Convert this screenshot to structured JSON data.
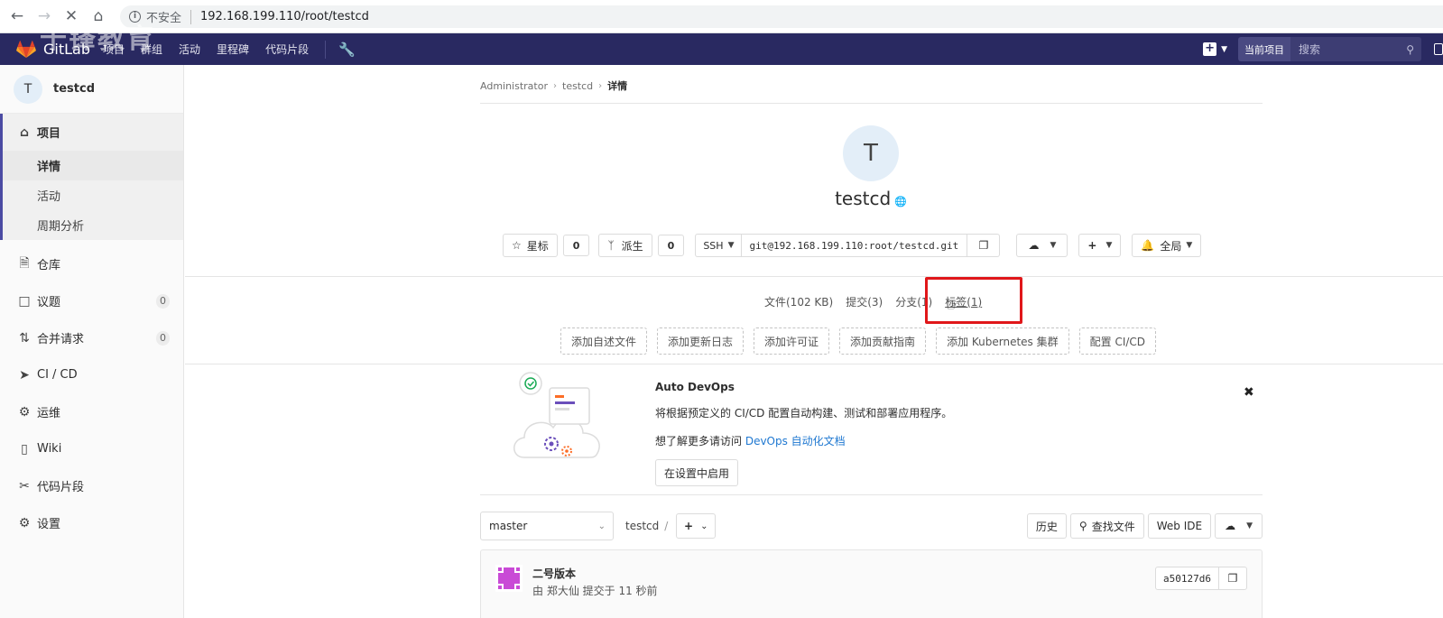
{
  "browser": {
    "insecure_label": "不安全",
    "url": "192.168.199.110/root/testcd",
    "back_icon": "arrow-left-icon",
    "forward_icon": "arrow-right-icon",
    "close_icon": "close-icon",
    "home_icon": "home-icon"
  },
  "navbar": {
    "brand": "GitLab",
    "menu": [
      "项目",
      "群组",
      "活动",
      "里程碑",
      "代码片段"
    ],
    "scope_label": "当前项目",
    "search_placeholder": "搜索",
    "watermark": "千锋教育"
  },
  "sidebar": {
    "project_initial": "T",
    "project_name": "testcd",
    "project_section": "项目",
    "sub_items": [
      "详情",
      "活动",
      "周期分析"
    ],
    "items": [
      {
        "label": "仓库",
        "icon": "repository-icon"
      },
      {
        "label": "议题",
        "icon": "issues-icon",
        "badge": "0"
      },
      {
        "label": "合并请求",
        "icon": "merge-request-icon",
        "badge": "0"
      },
      {
        "label": "CI / CD",
        "icon": "rocket-icon"
      },
      {
        "label": "运维",
        "icon": "operations-icon"
      },
      {
        "label": "Wiki",
        "icon": "book-icon"
      },
      {
        "label": "代码片段",
        "icon": "scissors-icon"
      },
      {
        "label": "设置",
        "icon": "gear-icon"
      }
    ]
  },
  "breadcrumb": {
    "items": [
      "Administrator",
      "testcd",
      "详情"
    ]
  },
  "project": {
    "initial": "T",
    "title": "testcd",
    "star_label": "星标",
    "star_count": "0",
    "fork_label": "派生",
    "fork_count": "0",
    "clone_protocol": "SSH",
    "clone_url": "git@192.168.199.110:root/testcd.git",
    "notification_label": "全局"
  },
  "stats": {
    "files": "文件(102 KB)",
    "commits": "提交(3)",
    "branches": "分支(1)",
    "tags": "标签(1)"
  },
  "quick_actions": [
    "添加自述文件",
    "添加更新日志",
    "添加许可证",
    "添加贡献指南",
    "添加 Kubernetes 集群",
    "配置 CI/CD"
  ],
  "devops": {
    "title": "Auto DevOps",
    "description": "将根据预定义的 CI/CD 配置自动构建、测试和部署应用程序。",
    "more_prefix": "想了解更多请访问 ",
    "more_link": "DevOps 自动化文档",
    "enable_button": "在设置中启用"
  },
  "tree": {
    "branch": "master",
    "path": "testcd",
    "history_label": "历史",
    "find_file_label": "查找文件",
    "web_ide_label": "Web IDE"
  },
  "commit": {
    "title": "二号版本",
    "meta": "由 郑大仙 提交于 11 秒前",
    "sha": "a50127d6"
  },
  "colors": {
    "navbar_bg": "#292961",
    "highlight_border": "#e0171a",
    "link": "#1f78d1"
  }
}
